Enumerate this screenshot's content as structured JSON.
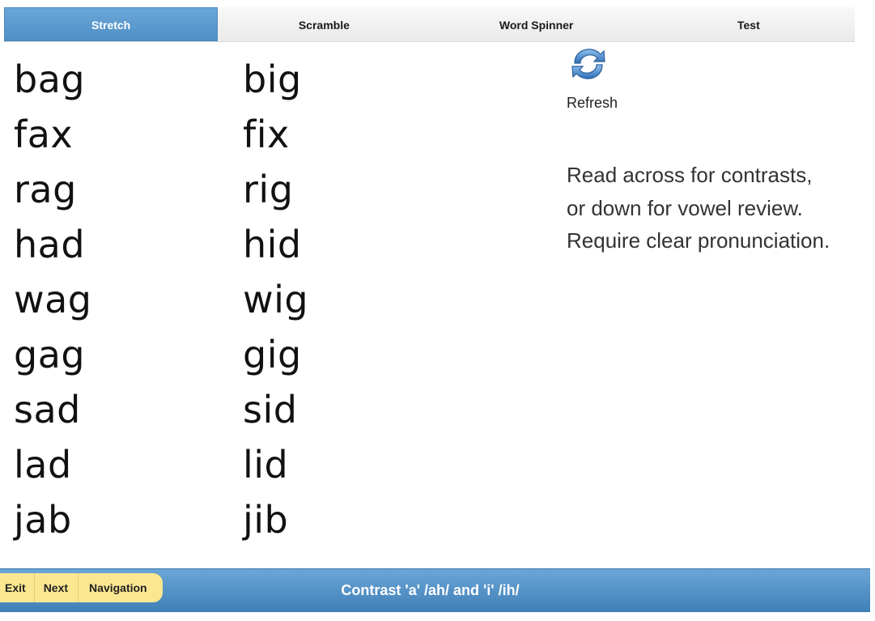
{
  "tabs": [
    {
      "label": "Stretch",
      "active": true
    },
    {
      "label": "Scramble",
      "active": false
    },
    {
      "label": "Word Spinner",
      "active": false
    },
    {
      "label": "Test",
      "active": false
    }
  ],
  "word_columns": {
    "a_words": [
      "bag",
      "fax",
      "rag",
      "had",
      "wag",
      "gag",
      "sad",
      "lad",
      "jab"
    ],
    "i_words": [
      "big",
      "fix",
      "rig",
      "hid",
      "wig",
      "gig",
      "sid",
      "lid",
      "jib"
    ]
  },
  "refresh": {
    "label": "Refresh",
    "icon": "refresh-icon"
  },
  "instructions": [
    "Read across for contrasts,",
    "or down for vowel review.",
    "Require clear pronunciation."
  ],
  "footer": {
    "buttons": {
      "exit": "Exit",
      "next": "Next",
      "navigation": "Navigation"
    },
    "title": "Contrast 'a' /ah/ and 'i' /ih/"
  },
  "colors": {
    "tab_active": "#5a9ad0",
    "footer_bar": "#4f8fc6",
    "footer_nav_bg": "#fce791",
    "refresh_icon": "#4a86c8"
  }
}
